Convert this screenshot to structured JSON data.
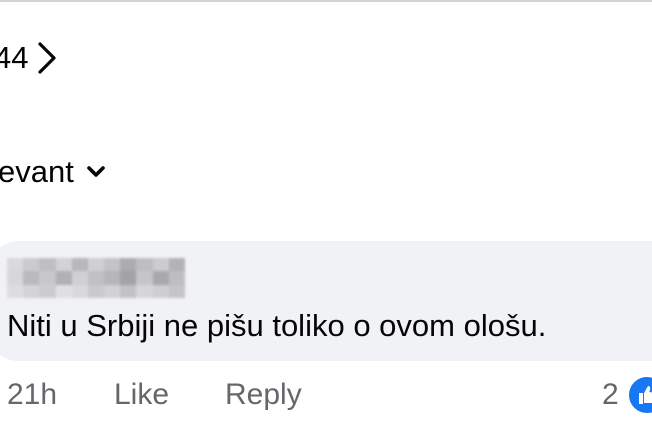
{
  "header": {
    "reactions_count": "44",
    "icon": "chevron-right-icon"
  },
  "sort": {
    "label": "evant",
    "icon": "chevron-down-icon"
  },
  "comment": {
    "author_name": "",
    "text": "Niti u Srbiji ne pišu toliko o ovom ološu.",
    "time": "21h",
    "like_label": "Like",
    "reply_label": "Reply",
    "reaction_count": "2",
    "reaction_icon": "like-reaction-icon"
  },
  "colors": {
    "bubble": "#f0f2f5",
    "text_primary": "#050505",
    "text_secondary": "#65676b",
    "like_blue": "#1877f2"
  }
}
